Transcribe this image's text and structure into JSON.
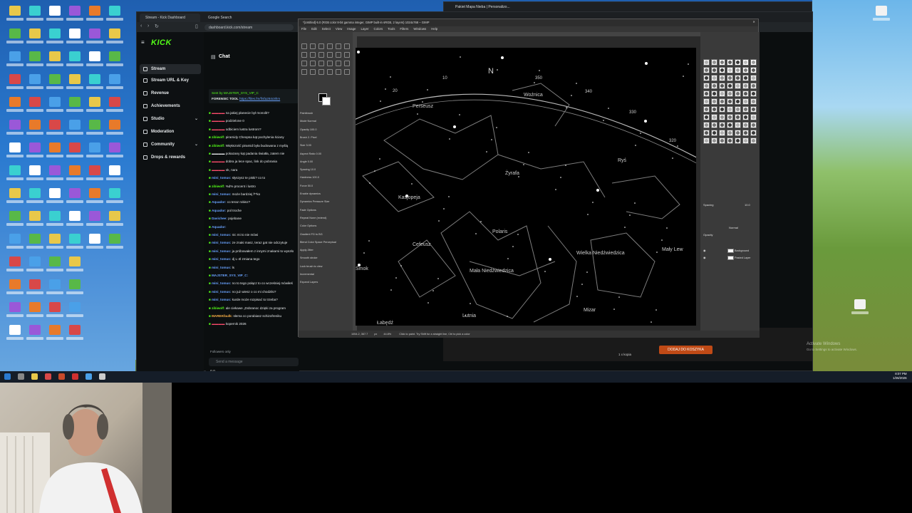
{
  "browser": {
    "tabs": [
      "Stream - Kick Dashboard",
      "Google Search"
    ],
    "address": "dashboard.kick.com/stream"
  },
  "kick": {
    "logo": "KICK",
    "nav": [
      {
        "label": "Stream",
        "active": true,
        "chevron": ""
      },
      {
        "label": "Stream URL & Key",
        "active": false,
        "chevron": ""
      },
      {
        "label": "Revenue",
        "active": false,
        "chevron": ""
      },
      {
        "label": "Achievements",
        "active": false,
        "chevron": ""
      },
      {
        "label": "Studio",
        "active": false,
        "chevron": "⌄"
      },
      {
        "label": "Moderation",
        "active": false,
        "chevron": ""
      },
      {
        "label": "Community",
        "active": false,
        "chevron": "⌄"
      },
      {
        "label": "Drops & rewards",
        "active": false,
        "chevron": ""
      }
    ]
  },
  "chat": {
    "title": "Chat",
    "pinned_author": "Sent by MAJSTER_SYS_VIP_C",
    "pinned_label": "FORENSIC TOOL",
    "pinned_link": "https://files.fm/f/sfa284c8hm",
    "messages": [
      {
        "user": "",
        "text": "na jakiej planecie był monolit?",
        "color": "#ff4d6d"
      },
      {
        "user": "",
        "text": "podzielone 0",
        "color": "#ff4d6d"
      },
      {
        "user": "",
        "text": "odbiciem lustra lustrom?",
        "color": "#ff4d6d"
      },
      {
        "user": "zibiwolf:",
        "text": "piramidy Cheopsa kąt pochylenia ściany",
        "color": "#53fc18"
      },
      {
        "user": "zibiwolf:",
        "text": "Większość piramid była budowana z myślą",
        "color": "#53fc18"
      },
      {
        "user": "",
        "text": "pokazany kąt padania światła, zatem nie",
        "color": "#e6e9eb"
      },
      {
        "user": "",
        "text": "dobra ja lece spac, link do pobrania",
        "color": "#ff4d6d"
      },
      {
        "user": "",
        "text": "ok, nara",
        "color": "#ff4d6d"
      },
      {
        "user": "mini_tomus:",
        "text": "słyszysz te piski? co to",
        "color": "#6aa3ff"
      },
      {
        "user": "zibiwolf:",
        "text": "%d% procent i lustro",
        "color": "#53fc18"
      },
      {
        "user": "mini_tomus:",
        "text": "może bardziej f**ko",
        "color": "#6aa3ff"
      },
      {
        "user": "Aquador:",
        "text": "co teraz robisz?",
        "color": "#6aa3ff"
      },
      {
        "user": "Aquador:",
        "text": "pol troche",
        "color": "#6aa3ff"
      },
      {
        "user": "Davichee:",
        "text": "pojebane",
        "color": "#6aa3ff"
      },
      {
        "user": "Aquador:",
        "text": "",
        "color": "#6aa3ff"
      },
      {
        "user": "mini_tomus:",
        "text": "nic mi to nie mówi",
        "color": "#6aa3ff"
      },
      {
        "user": "mini_tomus:",
        "text": "ze znaki masz, teraz gat nie odczytuje",
        "color": "#6aa3ff"
      },
      {
        "user": "mini_tomus:",
        "text": "ja próbowałem z innymi znakami to wyszło",
        "color": "#6aa3ff"
      },
      {
        "user": "mini_tomus:",
        "text": "dj L-4l zmiana tego",
        "color": "#6aa3ff"
      },
      {
        "user": "mini_tomus:",
        "text": "ls",
        "color": "#6aa3ff"
      },
      {
        "user": "MAJSTER_SYS_VIP_C:",
        "text": "",
        "color": "#6aa3ff"
      },
      {
        "user": "mini_tomus:",
        "text": "no to tego połącz to co wcześniej mówiłeś",
        "color": "#6aa3ff"
      },
      {
        "user": "mini_tomus:",
        "text": "no już wiesz o co mi chodziło?",
        "color": "#6aa3ff"
      },
      {
        "user": "mini_tomus:",
        "text": "kurde może rozpisać to trzeba?",
        "color": "#6aa3ff"
      },
      {
        "user": "zibiwolf:",
        "text": "ale ciekawe „Dobranoc dzięki za program",
        "color": "#53fc18"
      },
      {
        "user": "MAREKfaulk:",
        "text": "słema co porabiasz schizofreniku",
        "color": "#ffb347"
      },
      {
        "user": "",
        "text": "kopernik 2026",
        "color": "#ff4d6d"
      }
    ],
    "followers_only": "Followers only",
    "input_placeholder": "Send a message",
    "bottom_counts": "0   0"
  },
  "browser2": {
    "tab_title": "Pakiet Mapa Nieba | Personalizo..."
  },
  "shop": {
    "qty": "1 x kopia",
    "button": "DODAJ DO KOSZYKA"
  },
  "windows_watermark": {
    "line1": "Activate Windows",
    "line2": "Go to Settings to activate Windows."
  },
  "gimp": {
    "title": "*[Untitled]-5.0 (RGB color 8-bit gamma integer, GIMP built-in sRGB, 2 layers) 1024x768 – GIMP",
    "menu": [
      "File",
      "Edit",
      "Select",
      "View",
      "Image",
      "Layer",
      "Colors",
      "Tools",
      "Filters",
      "Windows",
      "Help"
    ],
    "tool_options": [
      "Paintbrush",
      "Mode  Normal",
      "Opacity  100.0",
      "Brush  2. Pixel",
      "Size  3.00",
      "Aspect Ratio  0.00",
      "Angle  0.00",
      "Spacing  10.0",
      "Hardness  100.0",
      "Force  50.0",
      "Enable dynamics",
      "Dynamics  Pressure Size",
      "Fade Options",
      "Repeat  None (extend)",
      "Color Options",
      "Gradient  FG to BG",
      "Blend Color Space  Perceptual",
      "Apply Jitter",
      "Smooth stroke",
      "Lock brush to view",
      "Incremental",
      "Expand Layers"
    ],
    "status_units": "px",
    "status_zoom": "44.8%",
    "status_coords": "1054.2, 367.7",
    "status_hint": "Click to paint. Try Shift for a straight line, Ctrl to pick a color",
    "dock_spacing_label": "Spacing",
    "dock_spacing_value": "10.0",
    "dock_mode": "Normal",
    "dock_opacity": "Opacity",
    "layers": [
      "Background",
      "Pasted Layer"
    ],
    "chart_labels": {
      "north": "N",
      "ticks": [
        "10",
        "20",
        "350",
        "340",
        "330",
        "320"
      ],
      "constellations": [
        "Woźnica",
        "Perseusz",
        "Ryś",
        "Żyrafa",
        "Kasjopeja",
        "Cefeusz",
        "Polaris",
        "Mała Niedźwiedzica",
        "Wielka Niedźwiedzica",
        "Mały Lew",
        "Smok",
        "Mizar",
        "Łabędź",
        "Lutnia"
      ]
    }
  },
  "taskbar": {
    "time": "8:07 PM",
    "date": "1/26/2026"
  },
  "colors": {
    "kick_green": "#53fc18",
    "gimp_dark": "#3c3c3c",
    "shop_orange": "#c04a16"
  }
}
